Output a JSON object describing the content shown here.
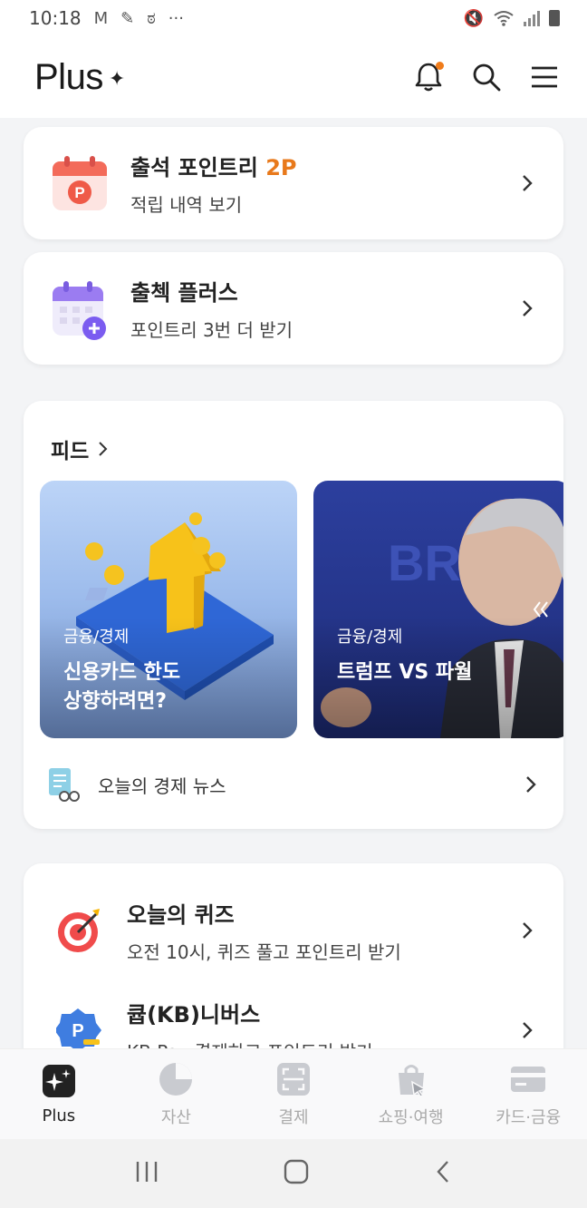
{
  "status_bar": {
    "time": "10:18",
    "more": "···"
  },
  "header": {
    "brand": "Plus",
    "brand_mark": "✦",
    "notification_dot_color": "#f07c1b"
  },
  "attendance_card": {
    "title": "출석 포인트리",
    "points": "2P",
    "subtitle": "적립 내역 보기",
    "icon": "calendar-p-icon"
  },
  "attendance_plus_card": {
    "title": "출첵 플러스",
    "subtitle": "포인트리 3번 더 받기",
    "icon": "calendar-plus-icon"
  },
  "feed": {
    "title": "피드",
    "cards": [
      {
        "category": "금융/경제",
        "headline_line1": "신용카드 한도",
        "headline_line2": "상향하려면?"
      },
      {
        "category": "금융/경제",
        "headline_line1": "트럼프 VS 파월",
        "headline_line2": ""
      }
    ],
    "news_link": "오늘의 경제 뉴스"
  },
  "quiz_card": {
    "title": "오늘의 퀴즈",
    "subtitle": "오전 10시, 퀴즈 풀고 포인트리 받기"
  },
  "kb_card": {
    "title": "큡(KB)니버스",
    "subtitle": "KB Pay 결제하고 포인트리 받기"
  },
  "bottom_nav": [
    {
      "label": "Plus",
      "icon": "plus-spark-icon",
      "active": true
    },
    {
      "label": "자산",
      "icon": "pie-chart-icon",
      "active": false
    },
    {
      "label": "결제",
      "icon": "scan-icon",
      "active": false
    },
    {
      "label": "쇼핑·여행",
      "icon": "shopping-bag-icon",
      "active": false
    },
    {
      "label": "카드·금융",
      "icon": "card-icon",
      "active": false
    }
  ],
  "colors": {
    "accent": "#e8791b",
    "background": "#f3f4f6"
  }
}
